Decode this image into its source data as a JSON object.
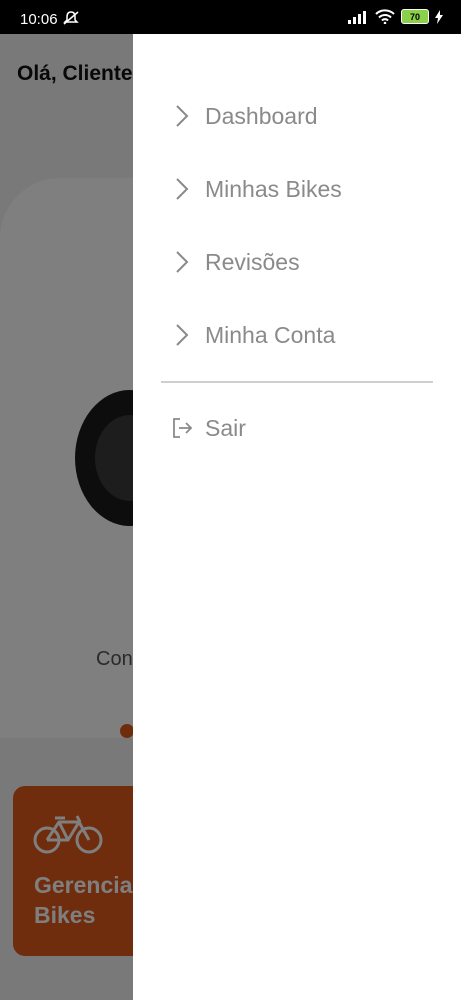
{
  "status_bar": {
    "time": "10:06",
    "battery": "70",
    "icons": [
      "mute-icon",
      "signal-icon",
      "wifi-icon",
      "battery-icon",
      "charging-icon"
    ]
  },
  "background_screen": {
    "greeting": "Olá, Cliente",
    "card_caption": "Con",
    "tile_label_line1": "Gerencia",
    "tile_label_line2": "Bikes",
    "accent_color": "#e05a1a"
  },
  "drawer": {
    "items": [
      {
        "label": "Dashboard",
        "icon": "chevron-right-icon"
      },
      {
        "label": "Minhas Bikes",
        "icon": "chevron-right-icon"
      },
      {
        "label": "Revisões",
        "icon": "chevron-right-icon"
      },
      {
        "label": "Minha Conta",
        "icon": "chevron-right-icon"
      }
    ],
    "logout": {
      "label": "Sair",
      "icon": "logout-icon"
    }
  }
}
